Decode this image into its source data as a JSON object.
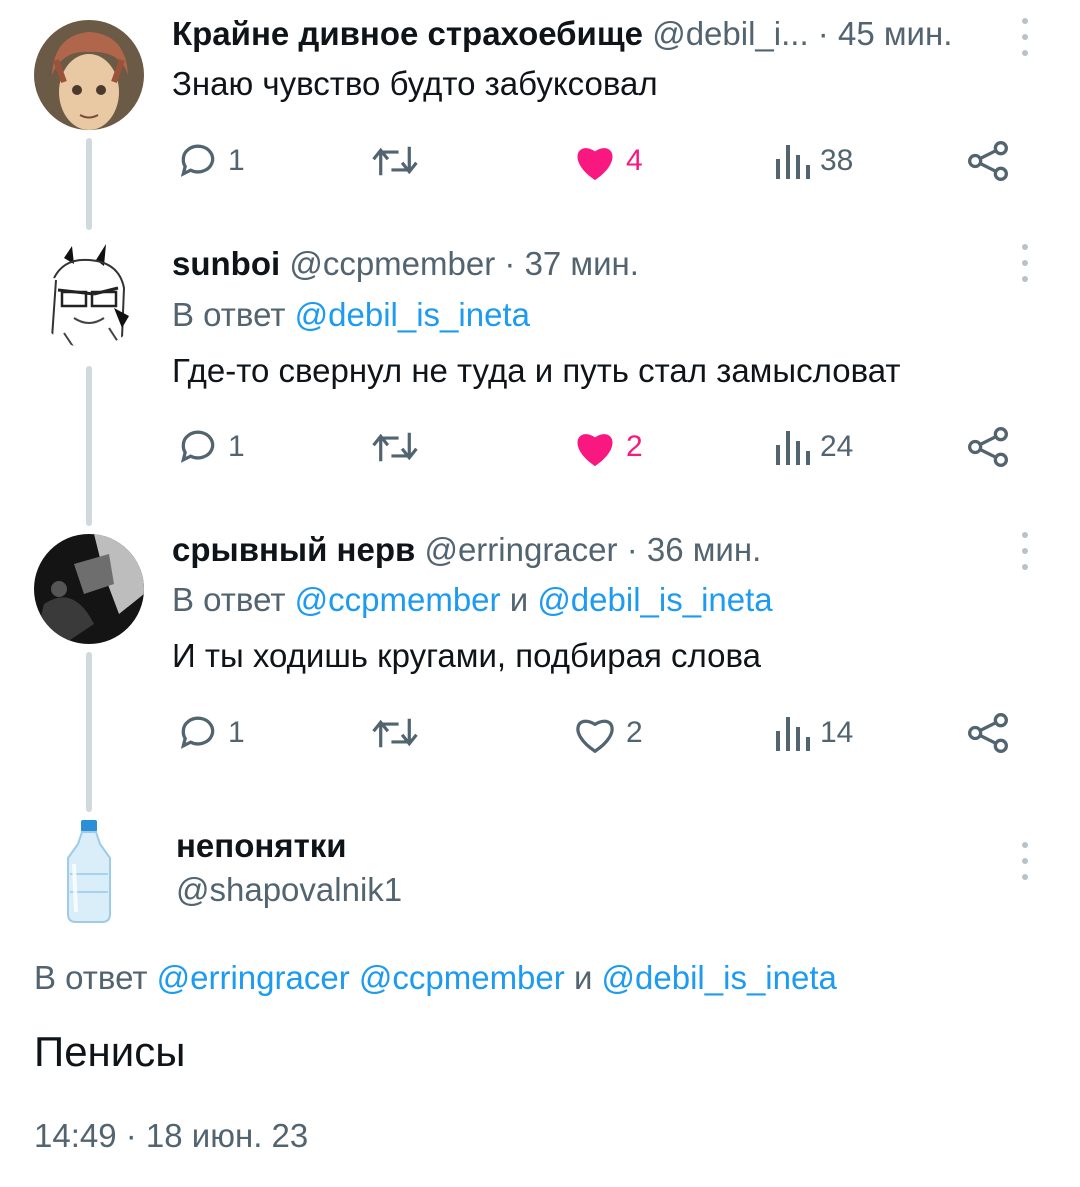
{
  "tweets": [
    {
      "name": "Крайне дивное страхоебище",
      "handle": "@debil_i...",
      "time": "45 мин.",
      "reply_prefix": "",
      "reply_links": [],
      "text": "Знаю чувство будто забуксовал",
      "replies": "1",
      "likes": "4",
      "liked": true,
      "views": "38"
    },
    {
      "name": "sunboi",
      "handle": "@ccpmember",
      "time": "37 мин.",
      "reply_prefix": "В ответ",
      "reply_links": [
        "@debil_is_ineta"
      ],
      "text": "Где-то свернул не туда и путь стал замысловат",
      "replies": "1",
      "likes": "2",
      "liked": true,
      "views": "24"
    },
    {
      "name": "срывный нерв",
      "handle": "@erringracer",
      "time": "36 мин.",
      "reply_prefix": "В ответ",
      "reply_links": [
        "@ccpmember",
        "@debil_is_ineta"
      ],
      "text": "И ты ходишь кругами, подбирая слова",
      "replies": "1",
      "likes": "2",
      "liked": false,
      "views": "14"
    }
  ],
  "main_tweet": {
    "name": "непонятки",
    "handle": "@shapovalnik1",
    "reply_prefix": "В ответ",
    "reply_links": [
      "@erringracer",
      "@ccpmember",
      "@debil_is_ineta"
    ],
    "joiner": "и",
    "text": "Пенисы",
    "timestamp": "14:49 · 18 июн. 23"
  },
  "separator": "·",
  "colors": {
    "accent": "#1d9bf0",
    "like": "#f91880",
    "muted": "#536471"
  },
  "icons": [
    "reply-icon",
    "retweet-icon",
    "like-icon",
    "views-icon",
    "share-icon",
    "more-icon"
  ]
}
